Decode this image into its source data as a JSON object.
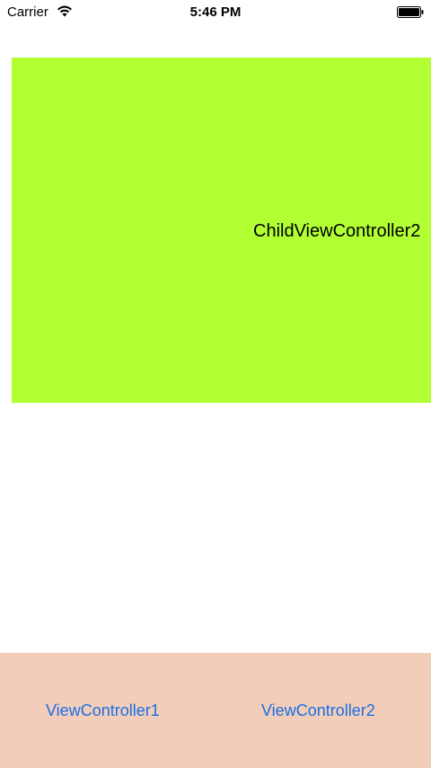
{
  "status_bar": {
    "carrier": "Carrier",
    "time": "5:46 PM",
    "wifi_icon": "wifi-icon",
    "battery_icon": "battery-icon"
  },
  "child_view": {
    "label": "ChildViewController2",
    "background": "#b2ff33"
  },
  "bottom_bar": {
    "background": "#f2cdb9",
    "buttons": [
      {
        "label": "ViewController1"
      },
      {
        "label": "ViewController2"
      }
    ],
    "button_color": "#1a6ee6"
  }
}
